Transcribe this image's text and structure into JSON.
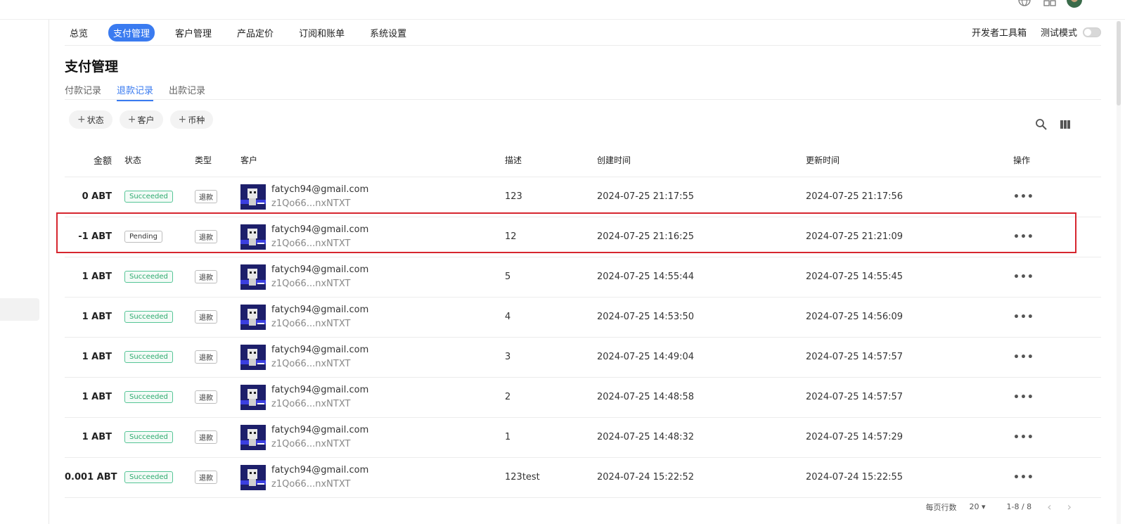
{
  "nav": {
    "items": [
      "总览",
      "支付管理",
      "客户管理",
      "产品定价",
      "订阅和账单",
      "系统设置"
    ],
    "active_index": 1,
    "dev_tools_label": "开发者工具箱",
    "test_mode_label": "测试模式",
    "test_mode_on": false
  },
  "page": {
    "title": "支付管理",
    "tabs": [
      "付款记录",
      "退款记录",
      "出款记录"
    ],
    "active_tab": 1
  },
  "filters": [
    "状态",
    "客户",
    "币种"
  ],
  "table": {
    "headers": {
      "amount": "金额",
      "status": "状态",
      "type": "类型",
      "customer": "客户",
      "description": "描述",
      "created": "创建时间",
      "updated": "更新时间",
      "actions": "操作"
    },
    "rows": [
      {
        "amount": "0 ABT",
        "status": "Succeeded",
        "type": "退款",
        "email": "fatych94@gmail.com",
        "did": "z1Qo66...nxNTXT",
        "description": "123",
        "created": "2024-07-25 21:17:55",
        "updated": "2024-07-25 21:17:56"
      },
      {
        "amount": "-1 ABT",
        "status": "Pending",
        "type": "退款",
        "email": "fatych94@gmail.com",
        "did": "z1Qo66...nxNTXT",
        "description": "12",
        "created": "2024-07-25 21:16:25",
        "updated": "2024-07-25 21:21:09"
      },
      {
        "amount": "1 ABT",
        "status": "Succeeded",
        "type": "退款",
        "email": "fatych94@gmail.com",
        "did": "z1Qo66...nxNTXT",
        "description": "5",
        "created": "2024-07-25 14:55:44",
        "updated": "2024-07-25 14:55:45"
      },
      {
        "amount": "1 ABT",
        "status": "Succeeded",
        "type": "退款",
        "email": "fatych94@gmail.com",
        "did": "z1Qo66...nxNTXT",
        "description": "4",
        "created": "2024-07-25 14:53:50",
        "updated": "2024-07-25 14:56:09"
      },
      {
        "amount": "1 ABT",
        "status": "Succeeded",
        "type": "退款",
        "email": "fatych94@gmail.com",
        "did": "z1Qo66...nxNTXT",
        "description": "3",
        "created": "2024-07-25 14:49:04",
        "updated": "2024-07-25 14:57:57"
      },
      {
        "amount": "1 ABT",
        "status": "Succeeded",
        "type": "退款",
        "email": "fatych94@gmail.com",
        "did": "z1Qo66...nxNTXT",
        "description": "2",
        "created": "2024-07-25 14:48:58",
        "updated": "2024-07-25 14:57:57"
      },
      {
        "amount": "1 ABT",
        "status": "Succeeded",
        "type": "退款",
        "email": "fatych94@gmail.com",
        "did": "z1Qo66...nxNTXT",
        "description": "1",
        "created": "2024-07-25 14:48:32",
        "updated": "2024-07-25 14:57:29"
      },
      {
        "amount": "0.001 ABT",
        "status": "Succeeded",
        "type": "退款",
        "email": "fatych94@gmail.com",
        "did": "z1Qo66...nxNTXT",
        "description": "123test",
        "created": "2024-07-24 15:22:52",
        "updated": "2024-07-24 15:22:55"
      }
    ],
    "highlighted_row": 1,
    "more_symbol": "•••"
  },
  "pagination": {
    "rows_per_page_label": "每页行数",
    "rows_per_page": "20",
    "range": "1-8 / 8"
  },
  "icons": {
    "topbar": [
      "globe-icon",
      "grid-icon",
      "user-avatar"
    ],
    "toolbar": [
      "search-icon",
      "columns-icon"
    ]
  },
  "colors": {
    "accent": "#3a7bf0",
    "success": "#2eaa6f",
    "highlight_border": "#d6262f"
  }
}
